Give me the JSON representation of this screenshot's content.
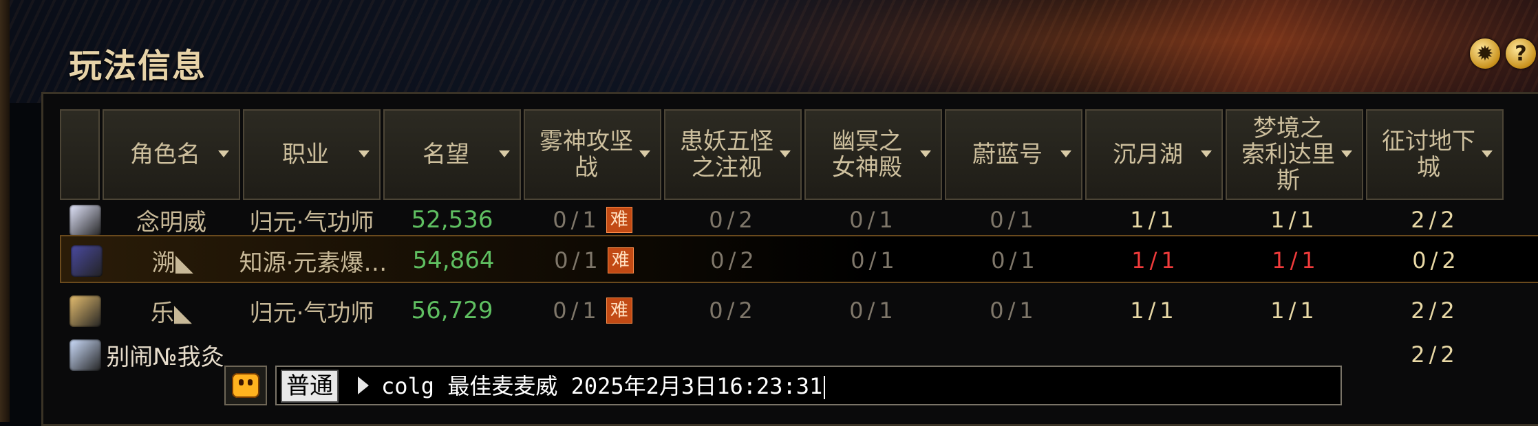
{
  "window": {
    "title": "玩法信息",
    "gear_icon": "gear-icon",
    "help_icon": "help-icon"
  },
  "columns": [
    {
      "key": "icon",
      "label": ""
    },
    {
      "key": "name",
      "label": "角色名"
    },
    {
      "key": "job",
      "label": "职业"
    },
    {
      "key": "fame",
      "label": "名望"
    },
    {
      "key": "d1",
      "label": "雾神攻坚\n战"
    },
    {
      "key": "d2",
      "label": "患妖五怪\n之注视"
    },
    {
      "key": "d3",
      "label": "幽冥之\n女神殿"
    },
    {
      "key": "d4",
      "label": "蔚蓝号"
    },
    {
      "key": "d5",
      "label": "沉月湖"
    },
    {
      "key": "d6",
      "label": "梦境之\n索利达里\n斯"
    },
    {
      "key": "d7",
      "label": "征讨地下\n城"
    }
  ],
  "badge_hard": "难",
  "rows": [
    {
      "name": "念明威",
      "job": "归元·气功师",
      "fame": "52,536",
      "d1": "0/1",
      "d2": "0/2",
      "d3": "0/1",
      "d4": "0/1",
      "d5": "1/1",
      "d6": "1/1",
      "d7": "2/2",
      "avatar_color": "#e5e8ff",
      "selected": false
    },
    {
      "name": "溯◣",
      "job": "知源·元素爆…",
      "fame": "54,864",
      "d1": "0/1",
      "d2": "0/2",
      "d3": "0/1",
      "d4": "0/1",
      "d5": "1/1",
      "d6": "1/1",
      "d7": "0/2",
      "avatar_color": "#4a4aa0",
      "selected": true
    },
    {
      "name": "乐◣",
      "job": "归元·气功师",
      "fame": "56,729",
      "d1": "0/1",
      "d2": "0/2",
      "d3": "0/1",
      "d4": "0/1",
      "d5": "1/1",
      "d6": "1/1",
      "d7": "2/2",
      "avatar_color": "#e8c070",
      "selected": false
    },
    {
      "name": "别闹№我灸",
      "d7": "2/2",
      "avatar_color": "#cfe0ff"
    }
  ],
  "chat": {
    "channel": "普通",
    "text": "colg 最佳麦麦威 2025年2月3日16:23:31",
    "emoji_icon": "emoji-icon"
  }
}
